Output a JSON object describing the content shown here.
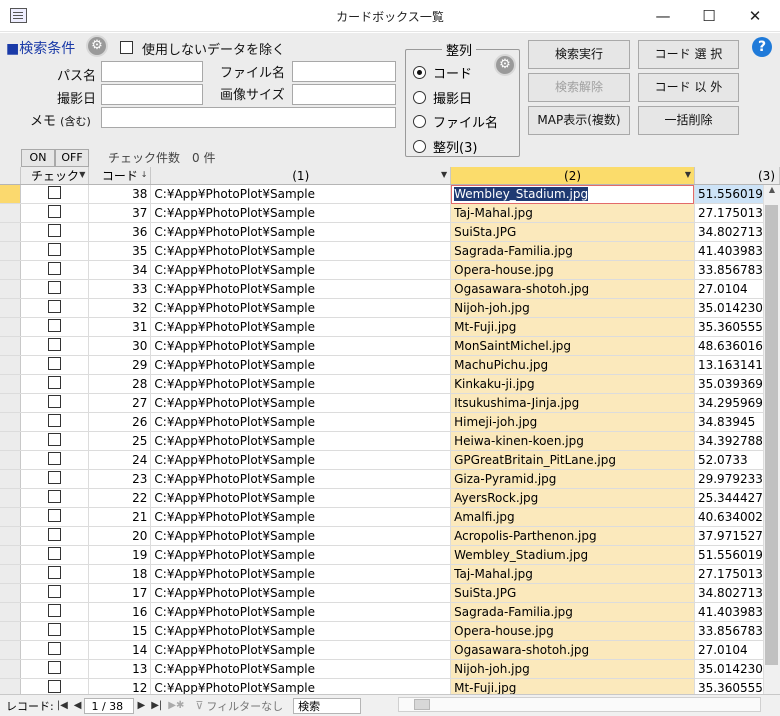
{
  "window": {
    "title": "カードボックス一覧",
    "minimize": "—",
    "maximize": "☐",
    "close": "✕"
  },
  "search": {
    "heading": "■検索条件",
    "exclude_label": "使用しないデータを除く",
    "path_label": "パス名",
    "file_label": "ファイル名",
    "date_label": "撮影日",
    "size_label": "画像サイズ",
    "memo_label": "メモ",
    "memo_hint": "(含む)"
  },
  "sort": {
    "title": "整列",
    "options": [
      "コード",
      "撮影日",
      "ファイル名",
      "整列(3)"
    ],
    "selected": "コード"
  },
  "buttons": {
    "run": "検索実行",
    "clear": "検索解除",
    "map": "MAP表示(複数)",
    "code_select": "コード 選 択",
    "code_except": "コード 以 外",
    "bulk_delete": "一括削除",
    "help": "?"
  },
  "toggles": {
    "on": "ON",
    "off": "OFF"
  },
  "check_count": "チェック件数　0 件",
  "columns": {
    "check": "チェック",
    "code": "コード",
    "c1": "(1)",
    "c2": "(2)",
    "c3": "(3)"
  },
  "rows": [
    {
      "code": "38",
      "path": "C:¥App¥PhotoPlot¥Sample",
      "file": "Wembley_Stadium.jpg",
      "lat": "51.556019"
    },
    {
      "code": "37",
      "path": "C:¥App¥PhotoPlot¥Sample",
      "file": "Taj-Mahal.jpg",
      "lat": "27.175013"
    },
    {
      "code": "36",
      "path": "C:¥App¥PhotoPlot¥Sample",
      "file": "SuiSta.JPG",
      "lat": "34.802713"
    },
    {
      "code": "35",
      "path": "C:¥App¥PhotoPlot¥Sample",
      "file": "Sagrada-Familia.jpg",
      "lat": "41.403983"
    },
    {
      "code": "34",
      "path": "C:¥App¥PhotoPlot¥Sample",
      "file": "Opera-house.jpg",
      "lat": "33.856783"
    },
    {
      "code": "33",
      "path": "C:¥App¥PhotoPlot¥Sample",
      "file": "Ogasawara-shotoh.jpg",
      "lat": "27.0104"
    },
    {
      "code": "32",
      "path": "C:¥App¥PhotoPlot¥Sample",
      "file": "Nijoh-joh.jpg",
      "lat": "35.014230"
    },
    {
      "code": "31",
      "path": "C:¥App¥PhotoPlot¥Sample",
      "file": "Mt-Fuji.jpg",
      "lat": "35.360555"
    },
    {
      "code": "30",
      "path": "C:¥App¥PhotoPlot¥Sample",
      "file": "MonSaintMichel.jpg",
      "lat": "48.636016"
    },
    {
      "code": "29",
      "path": "C:¥App¥PhotoPlot¥Sample",
      "file": "MachuPichu.jpg",
      "lat": "13.163141"
    },
    {
      "code": "28",
      "path": "C:¥App¥PhotoPlot¥Sample",
      "file": "Kinkaku-ji.jpg",
      "lat": "35.039369"
    },
    {
      "code": "27",
      "path": "C:¥App¥PhotoPlot¥Sample",
      "file": "Itsukushima-Jinja.jpg",
      "lat": "34.295969"
    },
    {
      "code": "26",
      "path": "C:¥App¥PhotoPlot¥Sample",
      "file": "Himeji-joh.jpg",
      "lat": "34.83945"
    },
    {
      "code": "25",
      "path": "C:¥App¥PhotoPlot¥Sample",
      "file": "Heiwa-kinen-koen.jpg",
      "lat": "34.392788"
    },
    {
      "code": "24",
      "path": "C:¥App¥PhotoPlot¥Sample",
      "file": "GPGreatBritain_PitLane.jpg",
      "lat": "52.0733"
    },
    {
      "code": "23",
      "path": "C:¥App¥PhotoPlot¥Sample",
      "file": "Giza-Pyramid.jpg",
      "lat": "29.979233"
    },
    {
      "code": "22",
      "path": "C:¥App¥PhotoPlot¥Sample",
      "file": "AyersRock.jpg",
      "lat": "25.344427"
    },
    {
      "code": "21",
      "path": "C:¥App¥PhotoPlot¥Sample",
      "file": "Amalfi.jpg",
      "lat": "40.634002"
    },
    {
      "code": "20",
      "path": "C:¥App¥PhotoPlot¥Sample",
      "file": "Acropolis-Parthenon.jpg",
      "lat": "37.971527"
    },
    {
      "code": "19",
      "path": "C:¥App¥PhotoPlot¥Sample",
      "file": "Wembley_Stadium.jpg",
      "lat": "51.556019"
    },
    {
      "code": "18",
      "path": "C:¥App¥PhotoPlot¥Sample",
      "file": "Taj-Mahal.jpg",
      "lat": "27.175013"
    },
    {
      "code": "17",
      "path": "C:¥App¥PhotoPlot¥Sample",
      "file": "SuiSta.JPG",
      "lat": "34.802713"
    },
    {
      "code": "16",
      "path": "C:¥App¥PhotoPlot¥Sample",
      "file": "Sagrada-Familia.jpg",
      "lat": "41.403983"
    },
    {
      "code": "15",
      "path": "C:¥App¥PhotoPlot¥Sample",
      "file": "Opera-house.jpg",
      "lat": "33.856783"
    },
    {
      "code": "14",
      "path": "C:¥App¥PhotoPlot¥Sample",
      "file": "Ogasawara-shotoh.jpg",
      "lat": "27.0104"
    },
    {
      "code": "13",
      "path": "C:¥App¥PhotoPlot¥Sample",
      "file": "Nijoh-joh.jpg",
      "lat": "35.014230"
    },
    {
      "code": "12",
      "path": "C:¥App¥PhotoPlot¥Sample",
      "file": "Mt-Fuji.jpg",
      "lat": "35.360555"
    }
  ],
  "nav": {
    "record_label": "レコード:",
    "current": "1 / 38",
    "filter": "フィルターなし",
    "search": "検索"
  }
}
